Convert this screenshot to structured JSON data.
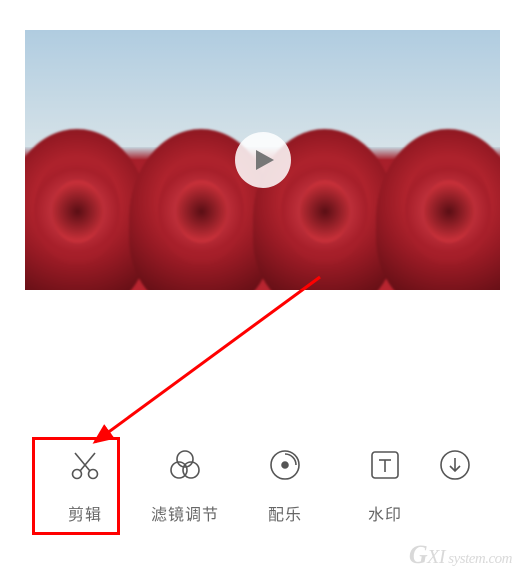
{
  "preview": {
    "play_icon": "play-icon"
  },
  "toolbar": {
    "items": [
      {
        "icon": "scissors-icon",
        "label": "剪辑"
      },
      {
        "icon": "filter-rings-icon",
        "label": "滤镜调节"
      },
      {
        "icon": "music-disc-icon",
        "label": "配乐"
      },
      {
        "icon": "text-icon",
        "label": "水印"
      },
      {
        "icon": "download-icon",
        "label": ""
      }
    ]
  },
  "highlight": {
    "target": "剪辑",
    "color": "#ff0000"
  },
  "watermark": "GXI system.com"
}
